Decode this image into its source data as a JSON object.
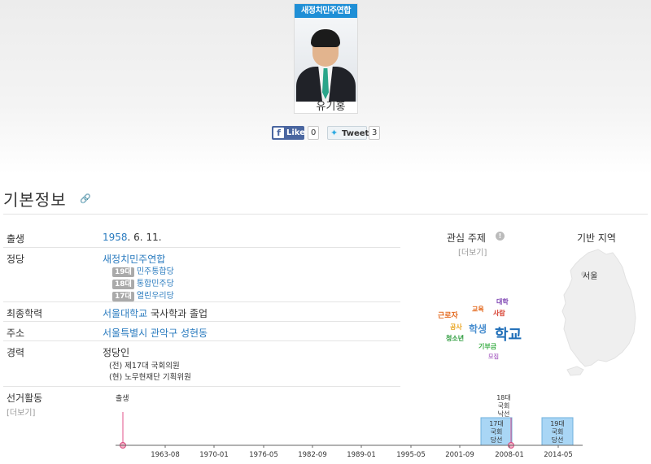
{
  "profile": {
    "party_badge": "새정치민주연합",
    "name": "유기홍"
  },
  "share": {
    "facebook_label": "Like",
    "facebook_count": "0",
    "twitter_label": "Tweet",
    "twitter_count": "3"
  },
  "section": {
    "title": "기본정보"
  },
  "info": {
    "birth_label": "출생",
    "birth_year": "1958",
    "birth_rest": ". 6. 11.",
    "party_label": "정당",
    "party_current": "새정치민주연합",
    "party_history": [
      {
        "era": "19대",
        "party": "민주통합당"
      },
      {
        "era": "18대",
        "party": "통합민주당"
      },
      {
        "era": "17대",
        "party": "열린우리당"
      }
    ],
    "education_label": "최종학력",
    "education_school": "서울대학교",
    "education_rest": " 국사학과 졸업",
    "address_label": "주소",
    "address_value": "서울특별시 관악구 성현동",
    "career_label": "경력",
    "career_main": "정당인",
    "career_items": [
      "(전) 제17대 국회의원",
      "(현) 노무현재단 기획위원"
    ],
    "election_label": "선거활동",
    "election_more": "[더보기]"
  },
  "interests": {
    "title": "관심 주제",
    "more": "[더보기]",
    "words": [
      {
        "text": "대학",
        "color": "#7a3fb0",
        "size": 8
      },
      {
        "text": "교육",
        "color": "#e46a1f",
        "size": 8
      },
      {
        "text": "사람",
        "color": "#d63a2a",
        "size": 8
      },
      {
        "text": "근로자",
        "color": "#e46a1f",
        "size": 9
      },
      {
        "text": "공사",
        "color": "#e8a21a",
        "size": 8
      },
      {
        "text": "학생",
        "color": "#4a8fd0",
        "size": 12
      },
      {
        "text": "학교",
        "color": "#1f6eb8",
        "size": 18
      },
      {
        "text": "청소년",
        "color": "#2a9a3a",
        "size": 8
      },
      {
        "text": "기부금",
        "color": "#3fb04a",
        "size": 8
      },
      {
        "text": "모집",
        "color": "#b070c8",
        "size": 7
      }
    ]
  },
  "region": {
    "title": "기반 지역",
    "label": "서울"
  },
  "timeline": {
    "ticks": [
      "1963-08",
      "1970-01",
      "1976-05",
      "1982-09",
      "1989-01",
      "1995-05",
      "2001-09",
      "2008-01",
      "2014-05"
    ],
    "birth_label": "출생",
    "events": [
      {
        "lines": [
          "18대",
          "국회",
          "낙선"
        ]
      },
      {
        "lines": [
          "17대",
          "국회",
          "당선"
        ]
      },
      {
        "lines": [
          "19대",
          "국회",
          "당선"
        ]
      }
    ]
  }
}
